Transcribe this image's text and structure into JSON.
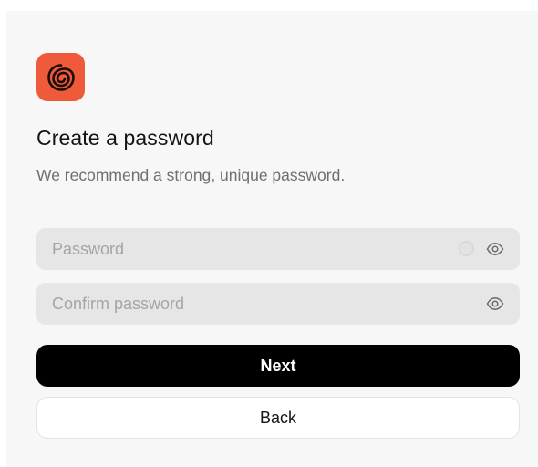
{
  "brand": {
    "logo_icon": "spiral-logo-icon",
    "accent_color": "#ee5a3a"
  },
  "heading": {
    "title": "Create a password",
    "subtitle": "We recommend a strong, unique password."
  },
  "form": {
    "password": {
      "value": "",
      "placeholder": "Password",
      "strength_icon": "strength-indicator-icon",
      "toggle_icon": "eye-icon"
    },
    "confirm_password": {
      "value": "",
      "placeholder": "Confirm password",
      "toggle_icon": "eye-icon"
    }
  },
  "actions": {
    "next_label": "Next",
    "back_label": "Back"
  }
}
